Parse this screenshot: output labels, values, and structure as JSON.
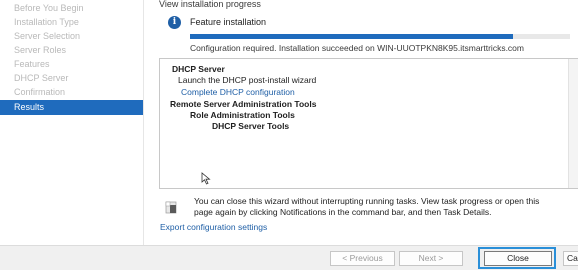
{
  "sidebar": {
    "items": [
      {
        "label": "Before You Begin",
        "active": false
      },
      {
        "label": "Installation Type",
        "active": false
      },
      {
        "label": "Server Selection",
        "active": false
      },
      {
        "label": "Server Roles",
        "active": false
      },
      {
        "label": "Features",
        "active": false
      },
      {
        "label": "DHCP Server",
        "active": false
      },
      {
        "label": "Confirmation",
        "active": false
      },
      {
        "label": "Results",
        "active": true
      }
    ]
  },
  "main": {
    "heading": "View installation progress",
    "feature_title": "Feature installation",
    "progress_fraction": 0.85,
    "status": "Configuration required. Installation succeeded on WIN-UUOTPKN8K95.itsmarttricks.com",
    "results": [
      {
        "text": "DHCP Server",
        "style": "bold"
      },
      {
        "text": "Launch the DHCP post-install wizard",
        "style": "normal"
      },
      {
        "text": "Complete DHCP configuration",
        "style": "link"
      },
      {
        "text": "Remote Server Administration Tools",
        "style": "bold"
      },
      {
        "text": "Role Administration Tools",
        "style": "bold"
      },
      {
        "text": "DHCP Server Tools",
        "style": "bold"
      }
    ],
    "note_line1": "You can close this wizard without interrupting running tasks. View task progress or open this",
    "note_line2": "page again by clicking Notifications in the command bar, and then Task Details.",
    "export_link": "Export configuration settings"
  },
  "footer": {
    "previous_label": "< Previous",
    "next_label": "Next >",
    "close_label": "Close",
    "cancel_label": "Cancel"
  },
  "colors": {
    "accent": "#1f6bbd",
    "link": "#1f5fa6",
    "highlight": "#2a8fd8"
  }
}
